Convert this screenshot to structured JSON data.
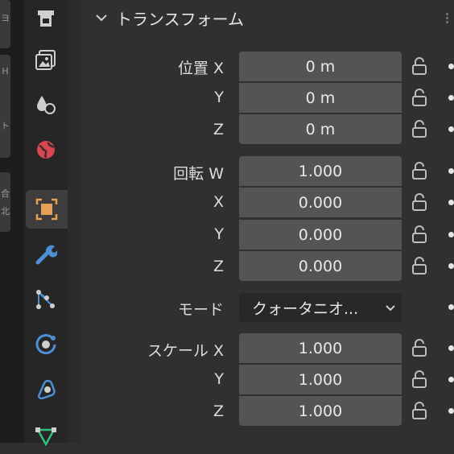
{
  "panel": {
    "title": "トランスフォーム"
  },
  "location": {
    "label": "位置 X",
    "y_label": "Y",
    "z_label": "Z",
    "x": "0 m",
    "y": "0 m",
    "z": "0 m"
  },
  "rotation": {
    "label": "回転 W",
    "x_label": "X",
    "y_label": "Y",
    "z_label": "Z",
    "w": "1.000",
    "x": "0.000",
    "y": "0.000",
    "z": "0.000"
  },
  "mode": {
    "label": "モード",
    "value": "クォータニオ..."
  },
  "scale": {
    "label": "スケール X",
    "y_label": "Y",
    "z_label": "Z",
    "x": "1.000",
    "y": "1.000",
    "z": "1.000"
  },
  "left_strip": {
    "tab1": "ヨ",
    "tab2": "H",
    "tab3": "ト",
    "tab4": "合",
    "tab5": "北"
  },
  "tabs": [
    "render-icon",
    "output-icon",
    "view-layer-icon",
    "world-icon",
    "object-icon",
    "modifier-icon",
    "particles-icon",
    "physics-icon",
    "constraints-icon",
    "data-icon"
  ],
  "colors": {
    "object_tab_accent": "#e8a056",
    "modifier_blue": "#4d8fd4",
    "world_red": "#d8474f",
    "data_green": "#33c07a"
  }
}
